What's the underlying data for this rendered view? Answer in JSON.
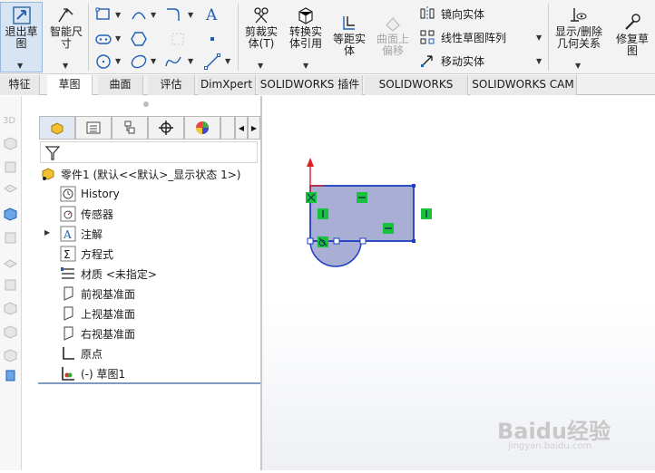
{
  "ribbon": {
    "exit_sketch": "退出草图",
    "smart_dimension": "智能尺寸",
    "trim_entities": "剪裁实体(T)",
    "convert_entities": "转换实体引用",
    "offset_entities": "等距实体",
    "offset_on_surface": "曲面上偏移",
    "mirror_entities": "镜向实体",
    "linear_pattern": "线性草图阵列",
    "move_entities": "移动实体",
    "display_relations": "显示/删除几何关系",
    "repair_sketch": "修复草图"
  },
  "tabs": [
    "特征",
    "草图",
    "曲面",
    "评估",
    "DimXpert",
    "SOLIDWORKS 插件",
    "SOLIDWORKS MBD",
    "SOLIDWORKS CAM"
  ],
  "active_tab": "草图",
  "tree": {
    "root": "零件1  (默认<<默认>_显示状态 1>)",
    "items": [
      {
        "label": "History",
        "icon": "history-icon"
      },
      {
        "label": "传感器",
        "icon": "sensor-icon"
      },
      {
        "label": "注解",
        "icon": "annotation-icon"
      },
      {
        "label": "方程式",
        "icon": "equation-icon"
      },
      {
        "label": "材质 <未指定>",
        "icon": "material-icon"
      },
      {
        "label": "前视基准面",
        "icon": "plane-icon"
      },
      {
        "label": "上视基准面",
        "icon": "plane-icon"
      },
      {
        "label": "右视基准面",
        "icon": "plane-icon"
      },
      {
        "label": "原点",
        "icon": "origin-icon"
      },
      {
        "label": "(-) 草图1",
        "icon": "sketch-icon"
      }
    ]
  },
  "watermark": {
    "brand": "Baidu经验",
    "url": "jingyan.baidu.com"
  },
  "colors": {
    "accent": "#2f5ea8",
    "sketch_fill": "#a8aed4",
    "sketch_line": "#1d3fc0",
    "relation": "#19c23c"
  }
}
